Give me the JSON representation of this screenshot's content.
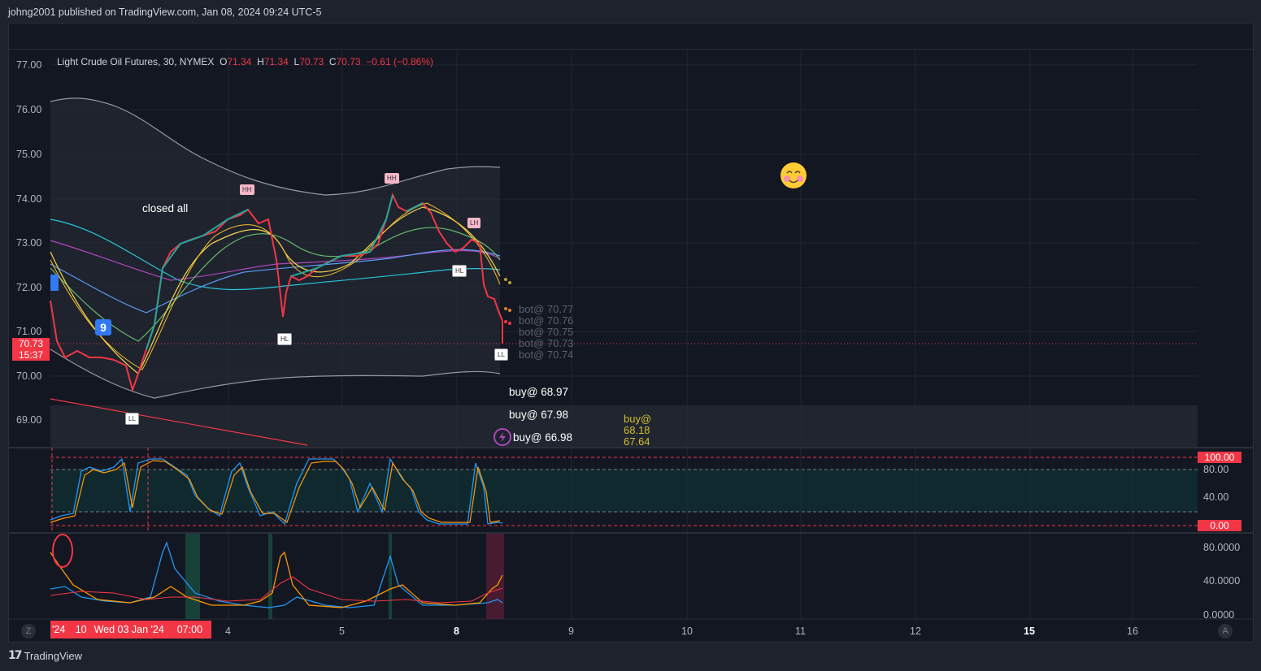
{
  "publisher": {
    "text": "johng2001 published on TradingView.com, Jan 08, 2024 09:24 UTC-5"
  },
  "legend": {
    "symbol": "Light Crude Oil Futures, 30, NYMEX",
    "o_label": "O",
    "o_value": "71.34",
    "h_label": "H",
    "h_value": "71.34",
    "l_label": "L",
    "l_value": "70.73",
    "c_label": "C",
    "c_value": "70.73",
    "change": "−0.61 (−0.86%)"
  },
  "price_tag": {
    "price": "70.73",
    "countdown": "15:37"
  },
  "y_axis_main": [
    "77.00",
    "76.00",
    "75.00",
    "74.00",
    "73.00",
    "72.00",
    "71.00",
    "70.00",
    "69.00"
  ],
  "y_axis_osc1": [
    "100.00",
    "80.00",
    "40.00",
    "0.00"
  ],
  "y_axis_osc2": [
    "80.0000",
    "40.0000",
    "0.0000"
  ],
  "x_axis": {
    "highlight": [
      "'24",
      "10",
      "Wed 03 Jan '24",
      "07:00"
    ],
    "labels": [
      "4",
      "5",
      "8",
      "9",
      "10",
      "11",
      "12",
      "15",
      "16"
    ]
  },
  "annotations": {
    "closed_all": "closed all",
    "bots": [
      "bot@ 70.77",
      "bot@ 70.76",
      "bot@ 70.75",
      "bot@ 70.73",
      "bot@ 70.74"
    ],
    "buys": [
      "buy@ 68.97",
      "buy@ 67.98",
      "buy@ 66.98"
    ],
    "buy_yellow": [
      "buy@",
      "68.18",
      "67.64"
    ]
  },
  "pivots": {
    "hh": "HH",
    "lh": "LH",
    "hl": "HL",
    "ll": "LL"
  },
  "badges": {
    "nine": "9"
  },
  "buttons": {
    "zoom": "Z",
    "auto": "A"
  },
  "footer": {
    "brand": "TradingView",
    "logo": "17"
  },
  "colors": {
    "up": "#26a69a",
    "down": "#f23645",
    "bg": "#131722",
    "accent": "#3179f5",
    "grid": "#2a2e39"
  }
}
